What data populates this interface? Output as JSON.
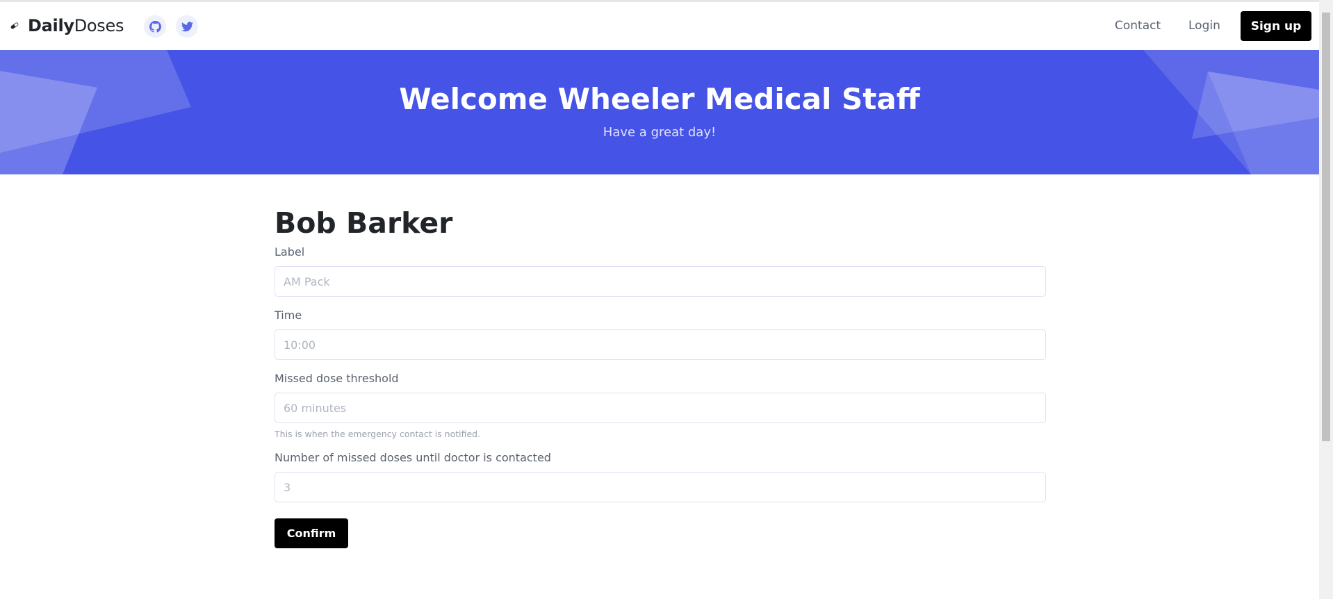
{
  "navbar": {
    "brand_bold": "Daily",
    "brand_light": "Doses",
    "links": {
      "contact": "Contact",
      "login": "Login"
    },
    "signup_label": "Sign up",
    "icons": {
      "brand": "pill-icon",
      "github": "github-icon",
      "twitter": "twitter-icon"
    }
  },
  "hero": {
    "title": "Welcome Wheeler Medical Staff",
    "subtitle": "Have a great day!"
  },
  "form": {
    "patient_name": "Bob Barker",
    "fields": {
      "label": {
        "label": "Label",
        "placeholder": "AM Pack"
      },
      "time": {
        "label": "Time",
        "placeholder": "10:00"
      },
      "threshold": {
        "label": "Missed dose threshold",
        "placeholder": "60 minutes",
        "help": "This is when the emergency contact is notified."
      },
      "missed": {
        "label": "Number of missed doses until doctor is contacted",
        "placeholder": "3"
      }
    },
    "confirm_label": "Confirm"
  },
  "colors": {
    "accent": "#4553e6",
    "button": "#000000",
    "social_icon": "#5b68e6"
  }
}
